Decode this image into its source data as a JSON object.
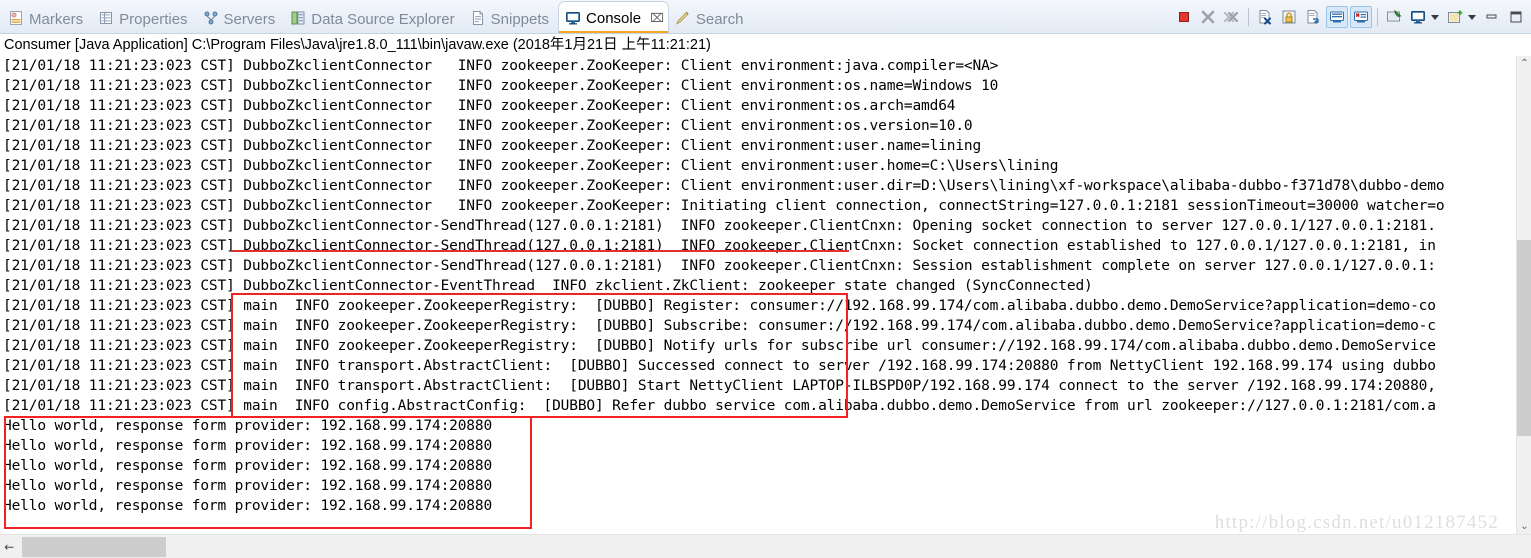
{
  "tabbar": {
    "tabs": [
      {
        "label": "Markers",
        "icon": "markers-icon",
        "active": false
      },
      {
        "label": "Properties",
        "icon": "properties-icon",
        "active": false
      },
      {
        "label": "Servers",
        "icon": "servers-icon",
        "active": false
      },
      {
        "label": "Data Source Explorer",
        "icon": "data-source-explorer-icon",
        "active": false
      },
      {
        "label": "Snippets",
        "icon": "snippets-icon",
        "active": false
      },
      {
        "label": "Console",
        "icon": "console-icon",
        "active": true,
        "close": "⌧"
      },
      {
        "label": "Search",
        "icon": "search-icon",
        "active": false
      }
    ]
  },
  "toolbar": {
    "buttons": [
      {
        "name": "terminate-button",
        "tooltip": "Terminate"
      },
      {
        "name": "remove-launch-button",
        "tooltip": "Remove Launch"
      },
      {
        "name": "remove-all-terminated-button",
        "tooltip": "Remove All Terminated Launches"
      },
      {
        "name": "clear-console-button",
        "tooltip": "Clear Console"
      },
      {
        "name": "scroll-lock-button",
        "tooltip": "Scroll Lock"
      },
      {
        "name": "word-wrap-button",
        "tooltip": "Word Wrap"
      },
      {
        "name": "show-console-on-output-button",
        "tooltip": "Show Console When Standard Out Changes"
      },
      {
        "name": "show-console-on-error-button",
        "tooltip": "Show Console When Standard Error Changes"
      },
      {
        "name": "pin-console-button",
        "tooltip": "Pin Console"
      },
      {
        "name": "display-selected-console-button",
        "tooltip": "Display Selected Console"
      },
      {
        "name": "open-console-button",
        "tooltip": "Open Console"
      },
      {
        "name": "minimize-button",
        "tooltip": "Minimize"
      },
      {
        "name": "maximize-button",
        "tooltip": "Maximize"
      }
    ]
  },
  "console": {
    "title": "Consumer [Java Application] C:\\Program Files\\Java\\jre1.8.0_111\\bin\\javaw.exe (2018年1月21日 上午11:21:21)",
    "lines": [
      "[21/01/18 11:21:23:023 CST] DubboZkclientConnector   INFO zookeeper.ZooKeeper: Client environment:java.compiler=<NA>",
      "[21/01/18 11:21:23:023 CST] DubboZkclientConnector   INFO zookeeper.ZooKeeper: Client environment:os.name=Windows 10",
      "[21/01/18 11:21:23:023 CST] DubboZkclientConnector   INFO zookeeper.ZooKeeper: Client environment:os.arch=amd64",
      "[21/01/18 11:21:23:023 CST] DubboZkclientConnector   INFO zookeeper.ZooKeeper: Client environment:os.version=10.0",
      "[21/01/18 11:21:23:023 CST] DubboZkclientConnector   INFO zookeeper.ZooKeeper: Client environment:user.name=lining",
      "[21/01/18 11:21:23:023 CST] DubboZkclientConnector   INFO zookeeper.ZooKeeper: Client environment:user.home=C:\\Users\\lining",
      "[21/01/18 11:21:23:023 CST] DubboZkclientConnector   INFO zookeeper.ZooKeeper: Client environment:user.dir=D:\\Users\\lining\\xf-workspace\\alibaba-dubbo-f371d78\\dubbo-demo",
      "[21/01/18 11:21:23:023 CST] DubboZkclientConnector   INFO zookeeper.ZooKeeper: Initiating client connection, connectString=127.0.0.1:2181 sessionTimeout=30000 watcher=o",
      "[21/01/18 11:21:23:023 CST] DubboZkclientConnector-SendThread(127.0.0.1:2181)  INFO zookeeper.ClientCnxn: Opening socket connection to server 127.0.0.1/127.0.0.1:2181.",
      "[21/01/18 11:21:23:023 CST] DubboZkclientConnector-SendThread(127.0.0.1:2181)  INFO zookeeper.ClientCnxn: Socket connection established to 127.0.0.1/127.0.0.1:2181, in",
      "[21/01/18 11:21:23:023 CST] DubboZkclientConnector-SendThread(127.0.0.1:2181)  INFO zookeeper.ClientCnxn: Session establishment complete on server 127.0.0.1/127.0.0.1:",
      "[21/01/18 11:21:23:023 CST] DubboZkclientConnector-EventThread  INFO zkclient.ZkClient: zookeeper state changed (SyncConnected)",
      "[21/01/18 11:21:23:023 CST] main  INFO zookeeper.ZookeeperRegistry:  [DUBBO] Register: consumer://192.168.99.174/com.alibaba.dubbo.demo.DemoService?application=demo-co",
      "[21/01/18 11:21:23:023 CST] main  INFO zookeeper.ZookeeperRegistry:  [DUBBO] Subscribe: consumer://192.168.99.174/com.alibaba.dubbo.demo.DemoService?application=demo-c",
      "[21/01/18 11:21:23:023 CST] main  INFO zookeeper.ZookeeperRegistry:  [DUBBO] Notify urls for subscribe url consumer://192.168.99.174/com.alibaba.dubbo.demo.DemoService",
      "[21/01/18 11:21:23:023 CST] main  INFO transport.AbstractClient:  [DUBBO] Successed connect to server /192.168.99.174:20880 from NettyClient 192.168.99.174 using dubbo",
      "[21/01/18 11:21:23:023 CST] main  INFO transport.AbstractClient:  [DUBBO] Start NettyClient LAPTOP-ILBSPD0P/192.168.99.174 connect to the server /192.168.99.174:20880,",
      "[21/01/18 11:21:23:023 CST] main  INFO config.AbstractConfig:  [DUBBO] Refer dubbo service com.alibaba.dubbo.demo.DemoService from url zookeeper://127.0.0.1:2181/com.a",
      "Hello world, response form provider: 192.168.99.174:20880",
      "Hello world, response form provider: 192.168.99.174:20880",
      "Hello world, response form provider: 192.168.99.174:20880",
      "Hello world, response form provider: 192.168.99.174:20880",
      "Hello world, response form provider: 192.168.99.174:20880"
    ]
  },
  "scrollbars": {
    "vertical_up_glyph": "⌃",
    "vertical_down_glyph": "⌄",
    "horizontal_left_glyph": "↖"
  },
  "watermark": {
    "text": "http://blog.csdn.net/u012187452"
  },
  "colors": {
    "accent_tab_underline": "#f5a623",
    "highlight_box": "#f02222",
    "toggled_button_bg": "#d7e9f9",
    "text": "#000000",
    "inactive_tab_text": "#808b99"
  }
}
